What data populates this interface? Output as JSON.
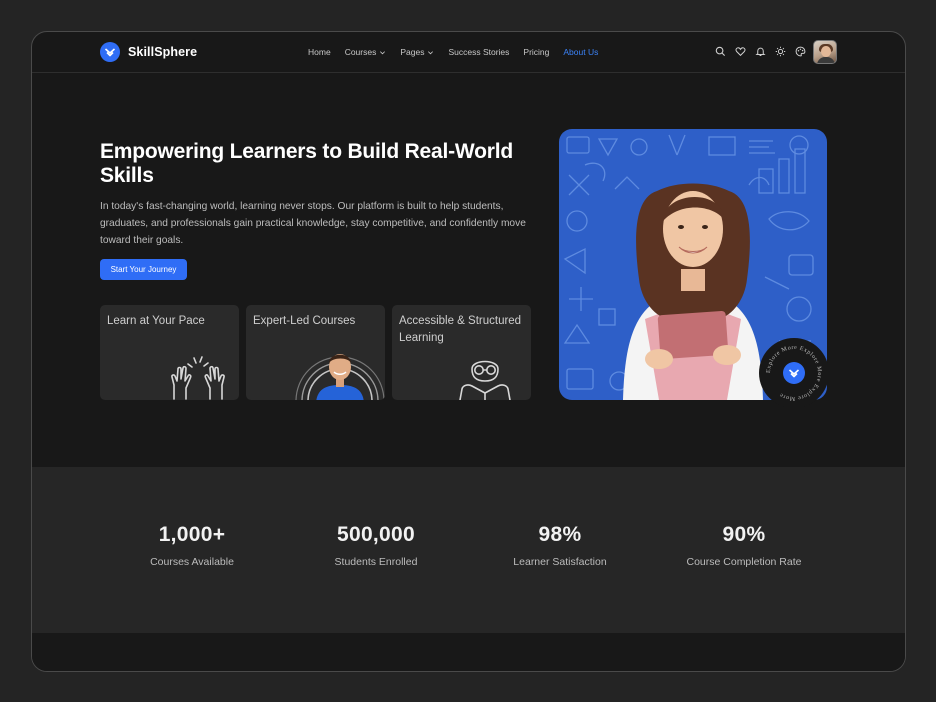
{
  "brand": {
    "name": "SkillSphere",
    "accent": "#2f6df6"
  },
  "nav": {
    "items": [
      {
        "label": "Home",
        "dropdown": false,
        "active": false
      },
      {
        "label": "Courses",
        "dropdown": true,
        "active": false
      },
      {
        "label": "Pages",
        "dropdown": true,
        "active": false
      },
      {
        "label": "Success Stories",
        "dropdown": false,
        "active": false
      },
      {
        "label": "Pricing",
        "dropdown": false,
        "active": false
      },
      {
        "label": "About Us",
        "dropdown": false,
        "active": true
      }
    ],
    "icons": [
      "search-icon",
      "heart-icon",
      "bell-icon",
      "sun-icon",
      "palette-icon"
    ]
  },
  "hero": {
    "title": "Empowering Learners to Build Real-World Skills",
    "description": "In today's fast-changing world, learning never stops. Our platform is built to help students, graduates, and professionals gain practical knowledge, stay competitive, and confidently move toward their goals.",
    "cta_label": "Start Your Journey",
    "badge_text": "Explore More Explore More Explore More"
  },
  "features": [
    {
      "title": "Learn at Your Pace",
      "icon": "high-five-icon"
    },
    {
      "title": "Expert-Led Courses",
      "icon": "student-photo"
    },
    {
      "title": "Accessible & Structured Learning",
      "icon": "reader-icon"
    }
  ],
  "stats": [
    {
      "value": "1,000+",
      "label": "Courses Available"
    },
    {
      "value": "500,000",
      "label": "Students Enrolled"
    },
    {
      "value": "98%",
      "label": "Learner Satisfaction"
    },
    {
      "value": "90%",
      "label": "Course Completion Rate"
    }
  ]
}
